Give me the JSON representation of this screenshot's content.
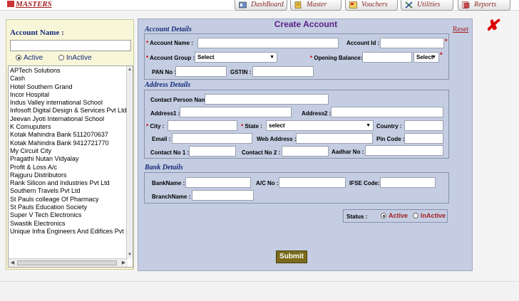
{
  "topbar": {
    "masters_label": "MASTERS",
    "nav": [
      {
        "label": "DashBoard"
      },
      {
        "label": "Master"
      },
      {
        "label": "Vouchers"
      },
      {
        "label": "Utilities"
      },
      {
        "label": "Reports"
      }
    ]
  },
  "left": {
    "account_name_label": "Account Name :",
    "search_value": "",
    "active_label": "Active",
    "inactive_label": "InActive",
    "accounts": [
      "APTech Solutions",
      "Cash",
      "Hotel Southern Grand",
      "Incor Hospital",
      "Indus Valley international School",
      "Infosoft Digital Design & Services Pvt Ltd",
      "Jeevan Jyoti International School",
      "K Comuputers",
      "Kotak Mahindra Bank 5112070637",
      "Kotak Mahindra Bank 9412721770",
      "My Circuit City",
      "Pragathi Nutan Vidyalay",
      "Profit & Loss A/c",
      "Rajguru Distributors",
      "Rank Silicon and Industries Pvt Ltd",
      "Southern Travels Pvt Ltd",
      "St Pauls colleage Of Pharmacy",
      "St Pauls Education Society",
      "Super V Tech Electronics",
      "Swastik Electronics",
      "Unique Infra Engineers And Edifices Pvt Ltd"
    ]
  },
  "form": {
    "title": "Create Account",
    "reset_label": "Reset",
    "close_glyph": "✘",
    "account_details": {
      "section": "Account Details",
      "account_name": "Account Name :",
      "account_id": "Account Id :",
      "account_group": "Account Group :",
      "account_group_value": "Select",
      "opening_balance": "Opening Balance:",
      "balance_type_value": "Select",
      "pan_no": "PAN No :",
      "gstin": "GSTIN :"
    },
    "address_details": {
      "section": "Address Details",
      "contact_person": "Contact Person Name:",
      "address1": "Address1 :",
      "address2": "Address2 :",
      "city": "City :",
      "state": "State :",
      "state_value": "select",
      "country": "Country :",
      "email": "Email :",
      "web_address": "Web Address :",
      "pin_code": "Pin Code :",
      "contact_no1": "Contact No 1 :",
      "contact_no2": "Contact No 2 :",
      "aadhar_no": "Aadhar No :"
    },
    "bank_details": {
      "section": "Bank Details",
      "bank_name": "BankName :",
      "ac_no": "A/C No :",
      "ifse_code": "IFSE Code:",
      "branch_name": "BranchName :"
    },
    "status": {
      "label": "Status :",
      "active": "Active",
      "inactive": "InActive"
    },
    "submit_label": "Submit"
  }
}
